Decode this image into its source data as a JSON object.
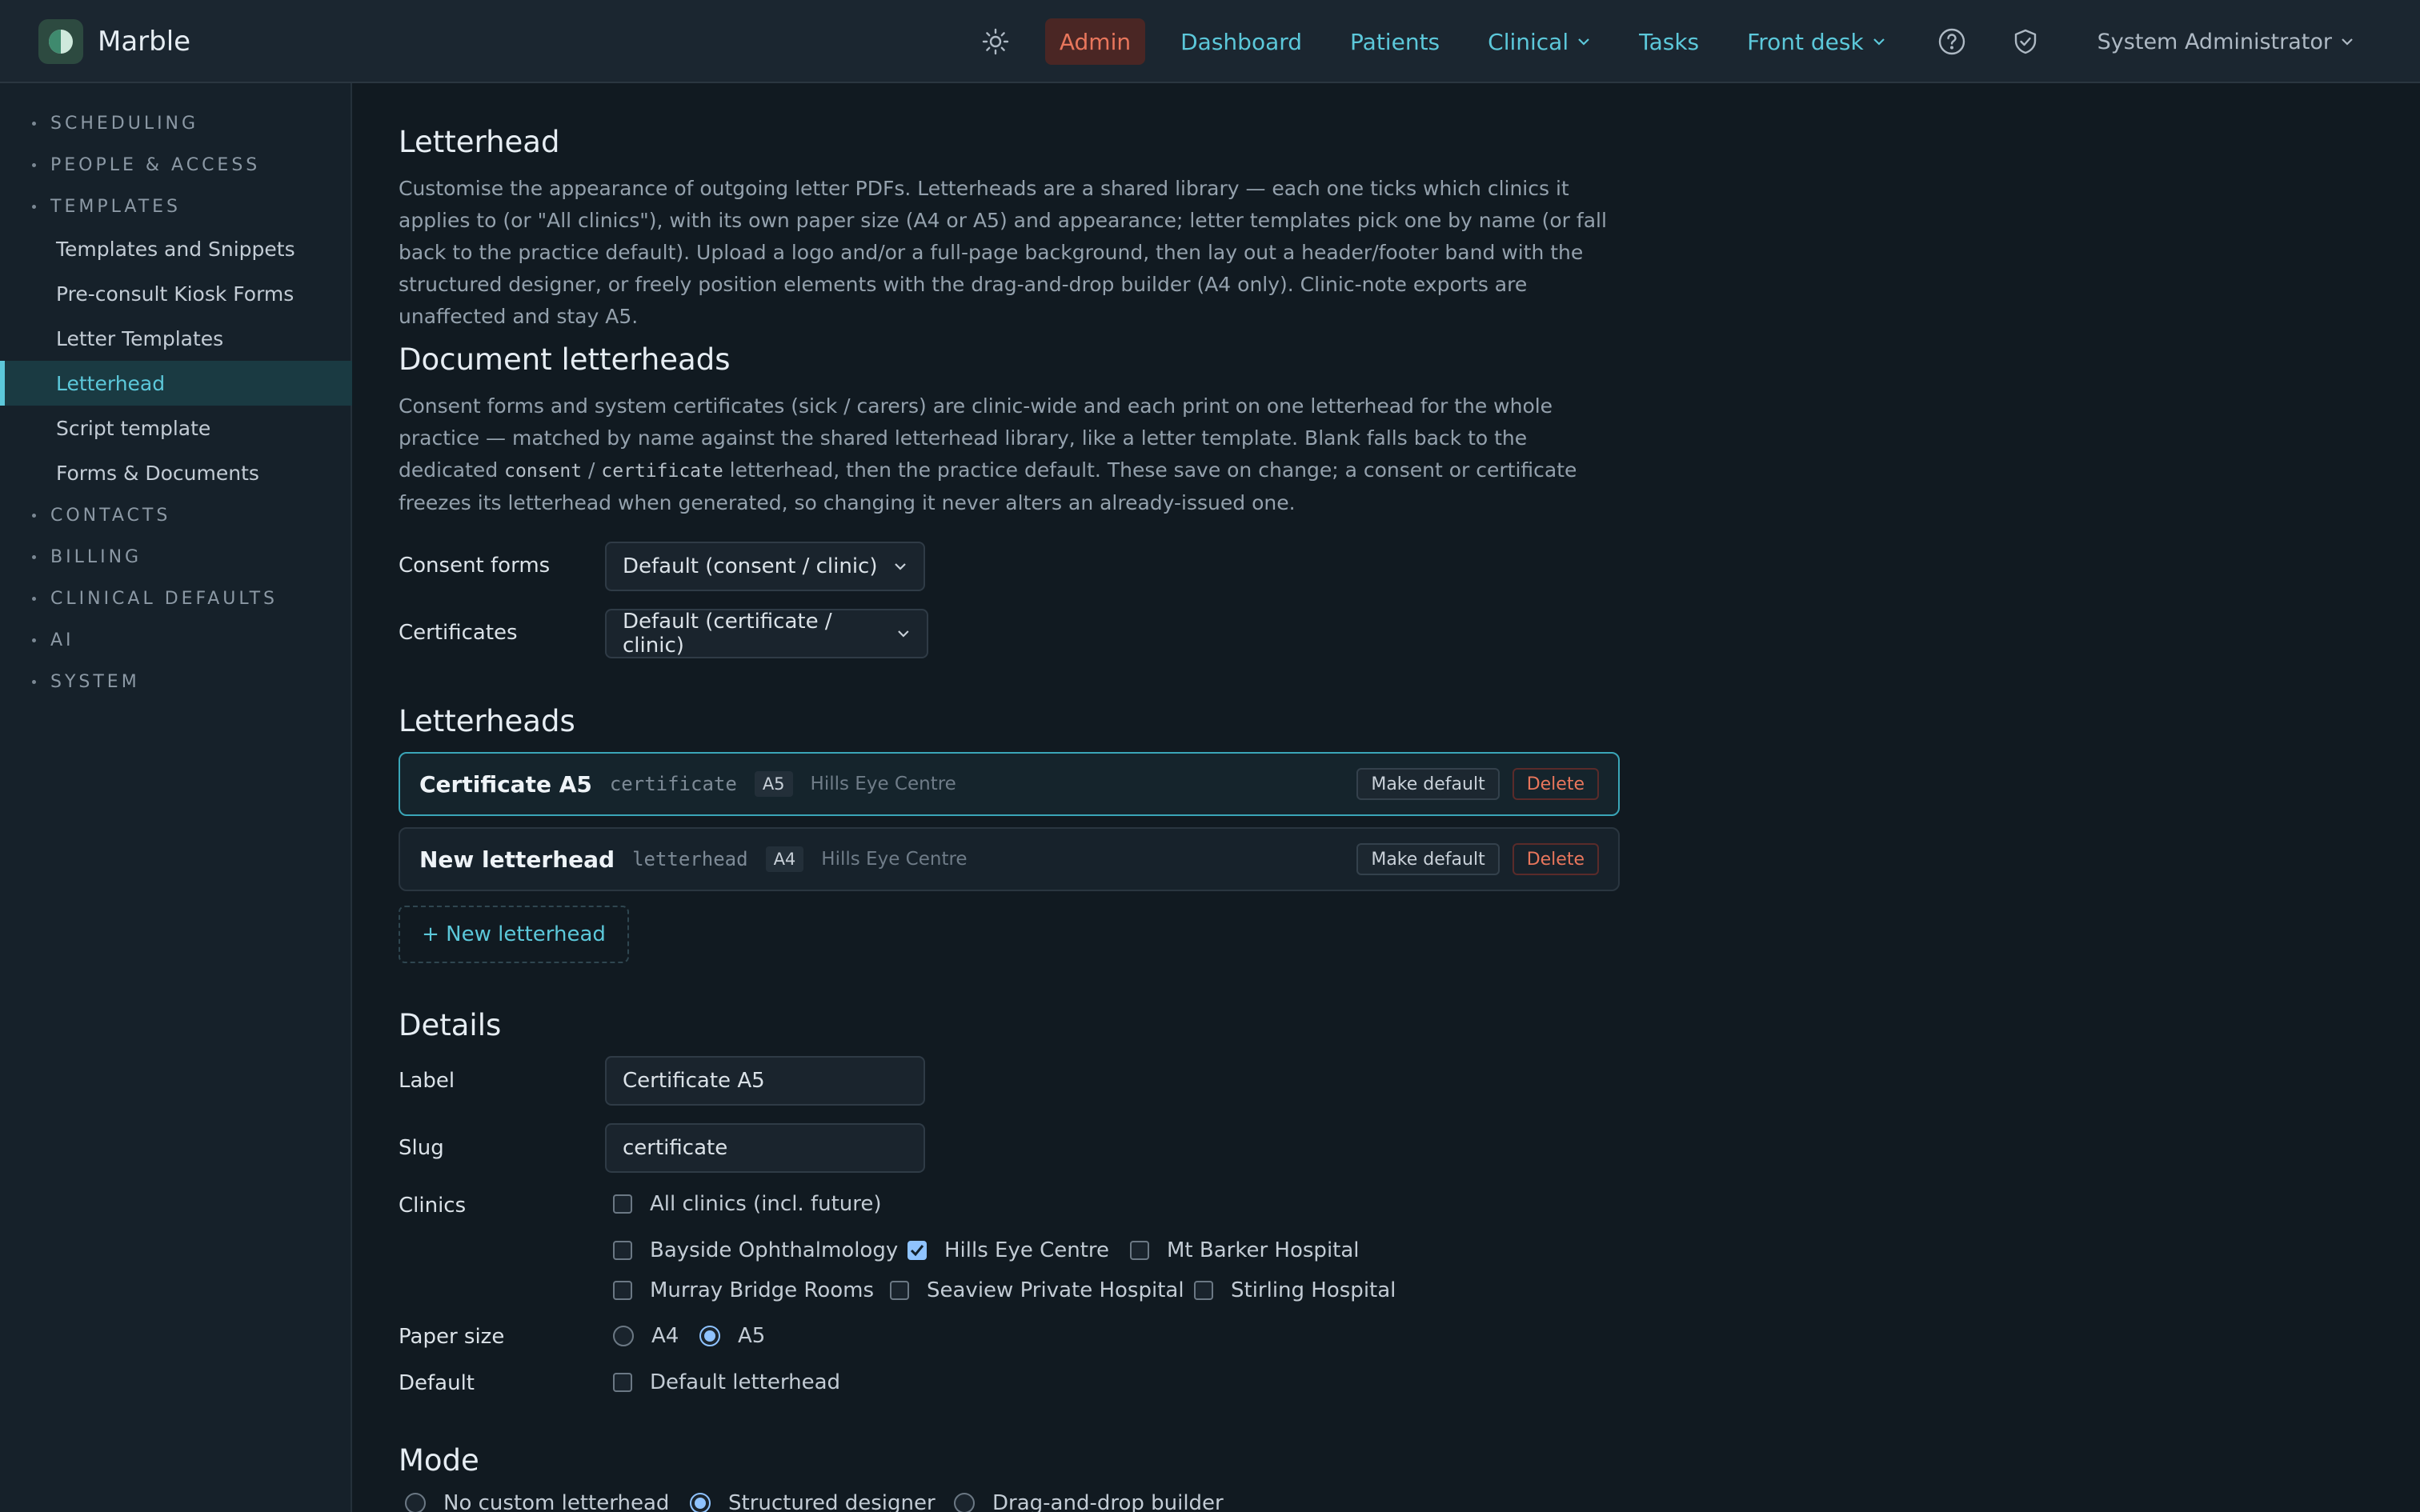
{
  "brand": {
    "name": "Marble"
  },
  "nav": {
    "admin": "Admin",
    "dashboard": "Dashboard",
    "patients": "Patients",
    "clinical": "Clinical",
    "tasks": "Tasks",
    "front_desk": "Front desk",
    "user": "System Administrator"
  },
  "sidebar": {
    "sections": {
      "scheduling": "SCHEDULING",
      "people_access": "PEOPLE & ACCESS",
      "templates": "TEMPLATES",
      "contacts": "CONTACTS",
      "billing": "BILLING",
      "clinical_defaults": "CLINICAL DEFAULTS",
      "ai": "AI",
      "system": "SYSTEM"
    },
    "items": [
      "Templates and Snippets",
      "Pre-consult Kiosk Forms",
      "Letter Templates",
      "Letterhead",
      "Script template",
      "Forms & Documents"
    ]
  },
  "letterhead": {
    "title": "Letterhead",
    "description": "Customise the appearance of outgoing letter PDFs. Letterheads are a shared library — each one ticks which clinics it applies to (or \"All clinics\"), with its own paper size (A4 or A5) and appearance; letter templates pick one by name (or fall back to the practice default). Upload a logo and/or a full-page background, then lay out a header/footer band with the structured designer, or freely position elements with the drag-and-drop builder (A4 only). Clinic-note exports are unaffected and stay A5."
  },
  "document_letterheads": {
    "title": "Document letterheads",
    "desc_1": "Consent forms and system certificates (sick / carers) are clinic-wide and each print on one letterhead for the whole practice — matched by name against the shared letterhead library, like a letter template. Blank falls back to the dedicated ",
    "code_consent": "consent",
    "desc_slash": " / ",
    "code_certificate": "certificate",
    "desc_2": " letterhead, then the practice default. These save on change; a consent or certificate freezes its letterhead when generated, so changing it never alters an already-issued one.",
    "consent_label": "Consent forms",
    "consent_value": "Default (consent / clinic)",
    "cert_label": "Certificates",
    "cert_value": "Default (certificate / clinic)"
  },
  "letterheads": {
    "title": "Letterheads",
    "rows": [
      {
        "name": "Certificate A5",
        "slug": "certificate",
        "size": "A5",
        "clinic": "Hills Eye Centre"
      },
      {
        "name": "New letterhead",
        "slug": "letterhead",
        "size": "A4",
        "clinic": "Hills Eye Centre"
      }
    ],
    "make_default": "Make default",
    "delete": "Delete",
    "new_button": "+ New letterhead"
  },
  "details": {
    "title": "Details",
    "label_label": "Label",
    "label_value": "Certificate A5",
    "slug_label": "Slug",
    "slug_value": "certificate",
    "clinics_label": "Clinics",
    "all_clinics": "All clinics (incl. future)",
    "clinics": [
      {
        "name": "Bayside Ophthalmology",
        "checked": false
      },
      {
        "name": "Hills Eye Centre",
        "checked": true
      },
      {
        "name": "Mt Barker Hospital",
        "checked": false
      },
      {
        "name": "Murray Bridge Rooms",
        "checked": false
      },
      {
        "name": "Seaview Private Hospital",
        "checked": false
      },
      {
        "name": "Stirling Hospital",
        "checked": false
      }
    ],
    "paper_label": "Paper size",
    "paper_a4": "A4",
    "paper_a5": "A5",
    "default_label": "Default",
    "default_option": "Default letterhead"
  },
  "mode": {
    "title": "Mode",
    "options": [
      "No custom letterhead",
      "Structured designer",
      "Drag-and-drop builder"
    ]
  }
}
